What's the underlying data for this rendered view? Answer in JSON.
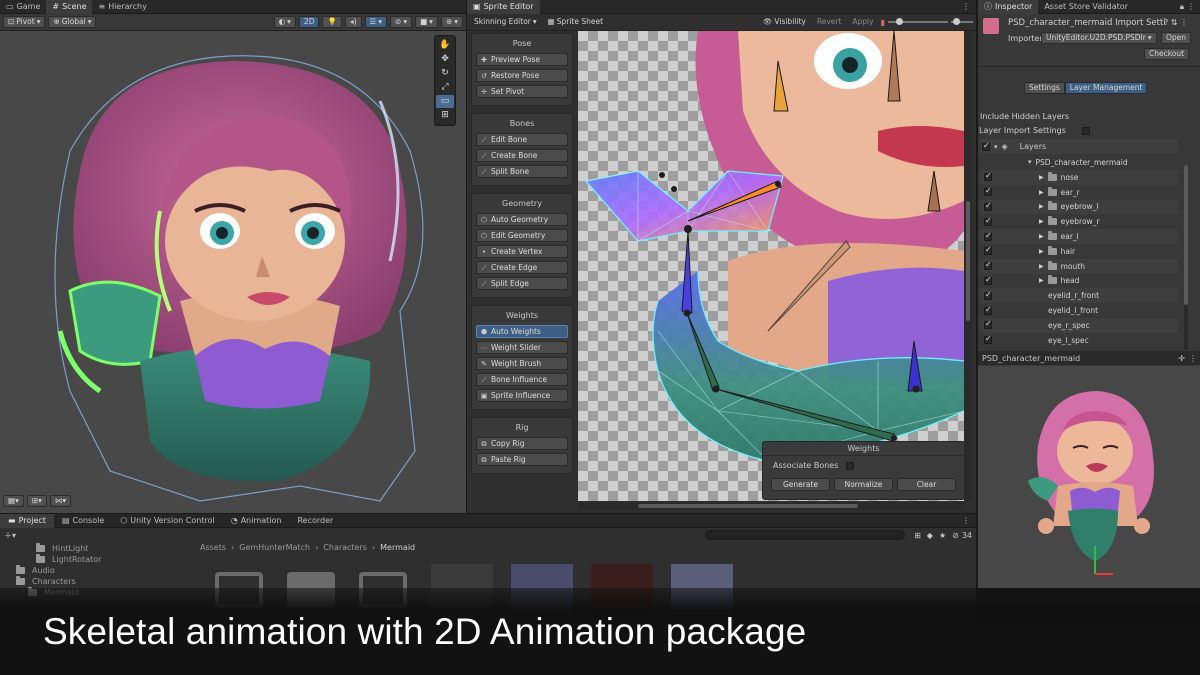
{
  "scene_panel": {
    "tabs": [
      {
        "label": "Game",
        "icon": "game-icon"
      },
      {
        "label": "Scene",
        "icon": "scene-icon"
      },
      {
        "label": "Hierarchy",
        "icon": "hierarchy-icon"
      }
    ],
    "toolbar": {
      "pivot": "Pivot",
      "space": "Global",
      "mode_2d": "2D"
    }
  },
  "sprite_editor": {
    "tab": "Sprite Editor",
    "mode_dropdown": "Skinning Editor",
    "sprite_sheet": "Sprite Sheet",
    "visibility": "Visibility",
    "revert": "Revert",
    "apply": "Apply",
    "groups": [
      {
        "title": "Pose",
        "buttons": [
          {
            "label": "Preview Pose",
            "icon": "preview-pose-icon"
          },
          {
            "label": "Restore Pose",
            "icon": "restore-pose-icon"
          },
          {
            "label": "Set Pivot",
            "icon": "pivot-icon"
          }
        ]
      },
      {
        "title": "Bones",
        "buttons": [
          {
            "label": "Edit Bone",
            "icon": "bone-icon"
          },
          {
            "label": "Create Bone",
            "icon": "bone-icon"
          },
          {
            "label": "Split Bone",
            "icon": "bone-icon"
          }
        ]
      },
      {
        "title": "Geometry",
        "buttons": [
          {
            "label": "Auto Geometry",
            "icon": "geometry-icon"
          },
          {
            "label": "Edit Geometry",
            "icon": "geometry-icon"
          },
          {
            "label": "Create Vertex",
            "icon": "vertex-icon"
          },
          {
            "label": "Create Edge",
            "icon": "edge-icon"
          },
          {
            "label": "Split Edge",
            "icon": "edge-icon"
          }
        ]
      },
      {
        "title": "Weights",
        "buttons": [
          {
            "label": "Auto Weights",
            "icon": "weights-icon",
            "active": true
          },
          {
            "label": "Weight Slider",
            "icon": "slider-icon"
          },
          {
            "label": "Weight Brush",
            "icon": "brush-icon"
          },
          {
            "label": "Bone Influence",
            "icon": "bone-influence-icon"
          },
          {
            "label": "Sprite Influence",
            "icon": "sprite-influence-icon"
          }
        ]
      },
      {
        "title": "Rig",
        "buttons": [
          {
            "label": "Copy Rig",
            "icon": "copy-icon"
          },
          {
            "label": "Paste Rig",
            "icon": "paste-icon"
          }
        ]
      }
    ],
    "weights_popup": {
      "title": "Weights",
      "associate_bones": "Associate Bones",
      "generate": "Generate",
      "normalize": "Normalize",
      "clear": "Clear"
    }
  },
  "inspector": {
    "tabs": [
      "Inspector",
      "Asset Store Validator"
    ],
    "asset_title": "PSD_character_mermaid Import Setti",
    "importer_label": "Importer",
    "importer_value": "UnityEditor.U2D.PSD.PSDIr",
    "open": "Open",
    "checkout": "Checkout",
    "subtabs": [
      "Settings",
      "Layer Management"
    ],
    "include_hidden": "Include Hidden Layers",
    "layer_import_settings": "Layer Import Settings",
    "layers_header": "Layers",
    "root_layer": "PSD_character_mermaid",
    "layers": [
      {
        "name": "nose",
        "folder": true
      },
      {
        "name": "ear_r",
        "folder": true
      },
      {
        "name": "eyebrow_l",
        "folder": true
      },
      {
        "name": "eyebrow_r",
        "folder": true
      },
      {
        "name": "ear_l",
        "folder": true
      },
      {
        "name": "hair",
        "folder": true
      },
      {
        "name": "mouth",
        "folder": true
      },
      {
        "name": "head",
        "folder": true
      },
      {
        "name": "eyelid_r_front",
        "folder": false
      },
      {
        "name": "eyelid_l_front",
        "folder": false
      },
      {
        "name": "eye_r_spec",
        "folder": false
      },
      {
        "name": "eye_l_spec",
        "folder": false
      }
    ],
    "preview_title": "PSD_character_mermaid"
  },
  "bottom_panel": {
    "tabs": [
      {
        "label": "Project",
        "icon": "folder-icon"
      },
      {
        "label": "Console",
        "icon": "console-icon"
      },
      {
        "label": "Unity Version Control",
        "icon": "version-control-icon"
      },
      {
        "label": "Animation",
        "icon": "animation-icon"
      },
      {
        "label": "Recorder",
        "icon": "recorder-icon"
      }
    ],
    "tree": [
      "HintLight",
      "LightRotator",
      "Audio",
      "Characters",
      "Mermaid"
    ],
    "breadcrumb": [
      "Assets",
      "GemHunterMatch",
      "Characters",
      "Mermaid"
    ],
    "item_count": "34"
  },
  "banner": {
    "text": "Skeletal animation with 2D Animation package"
  },
  "colors": {
    "accent_blue": "#3d5f85",
    "panel_bg": "#383838",
    "mesh_cyan": "#6ff0ff",
    "banner_bg": "#121212"
  }
}
